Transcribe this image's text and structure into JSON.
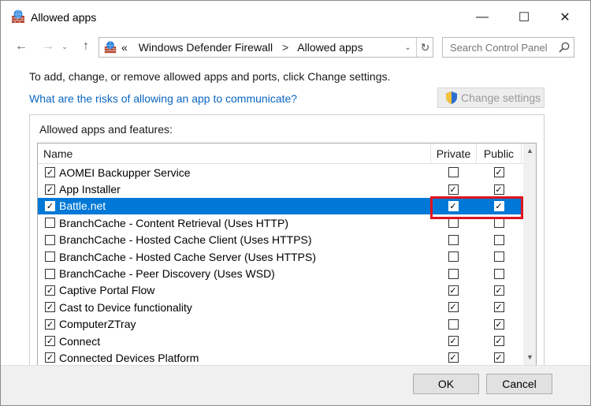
{
  "window": {
    "title": "Allowed apps",
    "minimize_glyph": "—",
    "maximize_glyph": "☐",
    "close_glyph": "✕"
  },
  "nav": {
    "back_glyph": "←",
    "forward_glyph": "→",
    "up_glyph": "↑",
    "history_glyph": "⌄",
    "address": {
      "prefix": "«",
      "path": [
        "Windows Defender Firewall",
        "Allowed apps"
      ],
      "separator": ">",
      "dropdown_glyph": "⌄",
      "refresh_glyph": "↻"
    },
    "search": {
      "placeholder": "Search Control Panel"
    }
  },
  "content": {
    "intro": "To add, change, or remove allowed apps and ports, click Change settings.",
    "risk_link": "What are the risks of allowing an app to communicate?",
    "change_settings": "Change settings",
    "group_label": "Allowed apps and features:",
    "columns": {
      "name": "Name",
      "private": "Private",
      "public": "Public"
    },
    "apps": [
      {
        "name": "AOMEI Backupper Service",
        "enabled": true,
        "private": false,
        "public": true,
        "selected": false
      },
      {
        "name": "App Installer",
        "enabled": true,
        "private": true,
        "public": true,
        "selected": false
      },
      {
        "name": "Battle.net",
        "enabled": true,
        "private": true,
        "public": true,
        "selected": true
      },
      {
        "name": "BranchCache - Content Retrieval (Uses HTTP)",
        "enabled": false,
        "private": false,
        "public": false,
        "selected": false
      },
      {
        "name": "BranchCache - Hosted Cache Client (Uses HTTPS)",
        "enabled": false,
        "private": false,
        "public": false,
        "selected": false
      },
      {
        "name": "BranchCache - Hosted Cache Server (Uses HTTPS)",
        "enabled": false,
        "private": false,
        "public": false,
        "selected": false
      },
      {
        "name": "BranchCache - Peer Discovery (Uses WSD)",
        "enabled": false,
        "private": false,
        "public": false,
        "selected": false
      },
      {
        "name": "Captive Portal Flow",
        "enabled": true,
        "private": true,
        "public": true,
        "selected": false
      },
      {
        "name": "Cast to Device functionality",
        "enabled": true,
        "private": true,
        "public": true,
        "selected": false
      },
      {
        "name": "ComputerZTray",
        "enabled": true,
        "private": false,
        "public": true,
        "selected": false
      },
      {
        "name": "Connect",
        "enabled": true,
        "private": true,
        "public": true,
        "selected": false
      },
      {
        "name": "Connected Devices Platform",
        "enabled": true,
        "private": true,
        "public": true,
        "selected": false
      }
    ]
  },
  "footer": {
    "ok": "OK",
    "cancel": "Cancel"
  },
  "colors": {
    "selection": "#0078d7",
    "link": "#0a66c2",
    "highlight": "#e0141e",
    "disabled_text": "#9a9a9a"
  },
  "icons": {
    "app": "firewall-icon",
    "address": "firewall-icon",
    "search": "search-icon",
    "change_settings": "shield-icon"
  }
}
